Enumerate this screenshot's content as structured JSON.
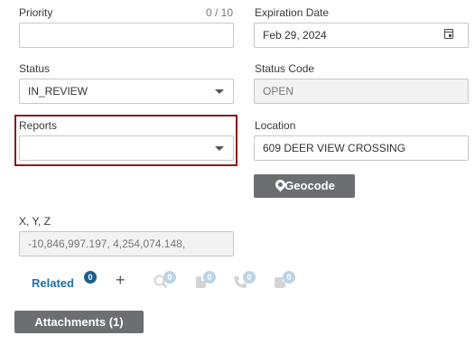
{
  "priority": {
    "label": "Priority",
    "counter": "0 / 10",
    "value": ""
  },
  "expiration": {
    "label": "Expiration Date",
    "value": "Feb 29, 2024",
    "icon": "calendar-icon"
  },
  "status": {
    "label": "Status",
    "value": "IN_REVIEW"
  },
  "status_code": {
    "label": "Status Code",
    "value": "OPEN"
  },
  "reports": {
    "label": "Reports",
    "value": ""
  },
  "location": {
    "label": "Location",
    "value": "609 DEER VIEW CROSSING"
  },
  "geocode": {
    "label": "Geocode",
    "icon": "map-pin-icon"
  },
  "xyz": {
    "label": "X, Y, Z",
    "value": "-10,846,997.197, 4,254,074.148,"
  },
  "related": {
    "label": "Related",
    "count": "0",
    "add_label": "+",
    "icons": [
      {
        "name": "search-related-icon",
        "count": "0"
      },
      {
        "name": "hand-related-icon",
        "count": "0"
      },
      {
        "name": "phone-related-icon",
        "count": "0"
      },
      {
        "name": "note-related-icon",
        "count": "0"
      }
    ]
  },
  "attachments": {
    "label": "Attachments (1)"
  },
  "colors": {
    "accent": "#1f6fa8",
    "button": "#6d6e72",
    "highlight": "#8b1b1b",
    "badge_light": "#bcd4e6"
  }
}
